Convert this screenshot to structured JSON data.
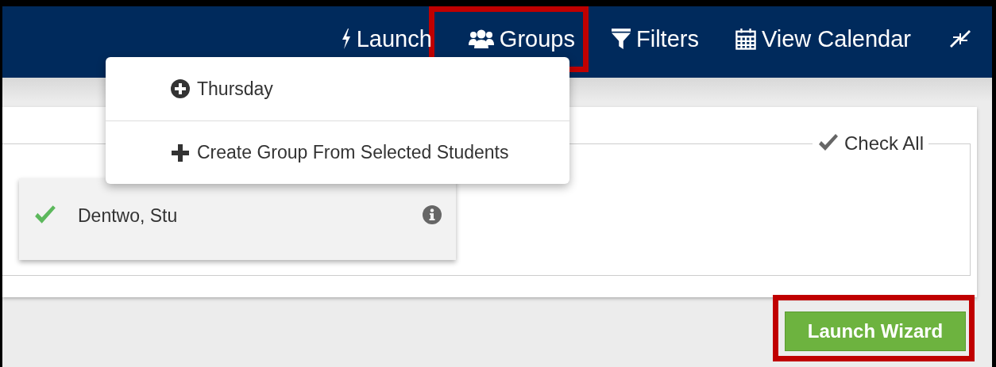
{
  "navbar": {
    "items": [
      {
        "label": "Launch"
      },
      {
        "label": "Groups"
      },
      {
        "label": "Filters"
      },
      {
        "label": "View Calendar"
      }
    ]
  },
  "groups_menu": {
    "items": [
      {
        "label": "Thursday",
        "kind": "group"
      },
      {
        "label": "Create Group From Selected Students",
        "kind": "create"
      }
    ]
  },
  "students": {
    "check_all": "Check All",
    "items": [
      {
        "name": "Dentwo, Stu",
        "checked": true
      }
    ]
  },
  "launch_button": "Launch Wizard"
}
